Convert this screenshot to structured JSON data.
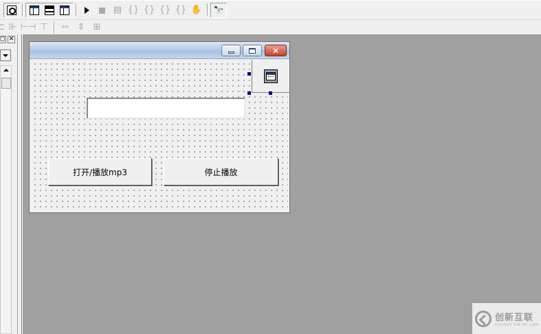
{
  "form": {
    "buttons": {
      "open_play": "打开/播放mp3",
      "stop_play": "停止播放"
    },
    "textbox_value": ""
  },
  "watermark": {
    "name_cn": "创新互联",
    "name_en": "CHUANG XIN HU LIAN"
  },
  "toolbar1": [
    {
      "icon": "property-sheet-icon"
    },
    {
      "icon": "layout-icon"
    },
    {
      "icon": "form-layout-icon"
    },
    {
      "icon": "form-editor-icon"
    },
    {
      "icon": "run-icon"
    },
    {
      "icon": "stop-icon"
    },
    {
      "icon": "compile-icon"
    },
    {
      "icon": "step-into-icon"
    },
    {
      "icon": "step-over-icon"
    },
    {
      "icon": "step-out-icon"
    },
    {
      "icon": "run-to-cursor-icon"
    },
    {
      "icon": "breakpoint-hand-icon"
    },
    {
      "icon": "find-icon"
    }
  ],
  "colors": {
    "workspace": "#a0a0a0",
    "chrome": "#f0f0f0",
    "selection_handle": "#000080",
    "close_button": "#c4442a"
  }
}
